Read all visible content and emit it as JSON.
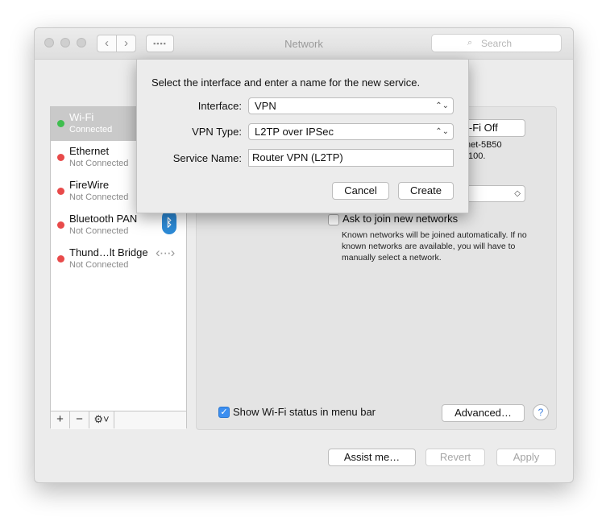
{
  "window": {
    "title": "Network",
    "search_placeholder": "Search"
  },
  "services": [
    {
      "name": "Wi-Fi",
      "status": "Connected",
      "dot_color": "#3fbe4f",
      "selected": true
    },
    {
      "name": "Ethernet",
      "status": "Not Connected",
      "dot_color": "#e84a4a"
    },
    {
      "name": "FireWire",
      "status": "Not Connected",
      "dot_color": "#e84a4a"
    },
    {
      "name": "Bluetooth PAN",
      "status": "Not Connected",
      "dot_color": "#e84a4a",
      "icon": "bluetooth-icon"
    },
    {
      "name": "Thund…lt Bridge",
      "status": "Not Connected",
      "dot_color": "#e84a4a",
      "icon": "bridge-icon"
    }
  ],
  "sidebar_tools": {
    "add": "+",
    "remove": "−",
    "gear": "⚙︎˅"
  },
  "panel": {
    "wifi_off_button": "i-Fi Off",
    "status_line1": "net-5B50",
    "status_line2": ".100.",
    "ask_label": "Ask to join new networks",
    "ask_help": "Known networks will be joined automatically. If no known networks are available, you will have to manually select a network.",
    "show_wifi_label": "Show Wi-Fi status in menu bar",
    "advanced_button": "Advanced…",
    "help_button": "?"
  },
  "footer": {
    "assist": "Assist me…",
    "revert": "Revert",
    "apply": "Apply"
  },
  "sheet": {
    "prompt": "Select the interface and enter a name for the new service.",
    "interface_label": "Interface:",
    "interface_value": "VPN",
    "vpn_type_label": "VPN Type:",
    "vpn_type_value": "L2TP over IPSec",
    "service_name_label": "Service Name:",
    "service_name_value": "Router VPN (L2TP)",
    "cancel": "Cancel",
    "create": "Create"
  },
  "colors": {
    "accent": "#3b8ef0",
    "selection": "#c9c9c9",
    "connected": "#3fbe4f",
    "disconnected": "#e84a4a"
  }
}
